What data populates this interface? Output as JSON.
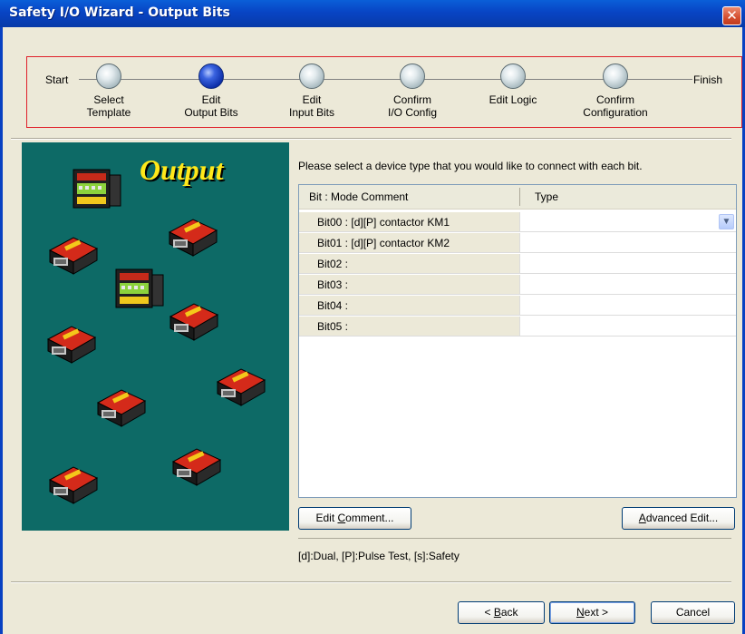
{
  "window": {
    "title": "Safety I/O Wizard - Output Bits"
  },
  "progress": {
    "start_label": "Start",
    "finish_label": "Finish",
    "steps": [
      {
        "label_line1": "Select",
        "label_line2": "Template",
        "active": false
      },
      {
        "label_line1": "Edit",
        "label_line2": "Output Bits",
        "active": true
      },
      {
        "label_line1": "Edit",
        "label_line2": "Input Bits",
        "active": false
      },
      {
        "label_line1": "Confirm",
        "label_line2": "I/O Config",
        "active": false
      },
      {
        "label_line1": "Edit Logic",
        "label_line2": "",
        "active": false
      },
      {
        "label_line1": "Confirm",
        "label_line2": "Configuration",
        "active": false
      }
    ]
  },
  "left_panel": {
    "title": "Output",
    "image": "safety-device-illustration"
  },
  "main": {
    "instruction": "Please select a device type that you would like to connect with each bit.",
    "grid": {
      "columns": [
        "Bit : Mode Comment",
        "Type"
      ],
      "rows": [
        {
          "bit": "Bit00 : [d][P] contactor KM1",
          "type": ""
        },
        {
          "bit": "Bit01 : [d][P] contactor KM2",
          "type": ""
        },
        {
          "bit": "Bit02 :",
          "type": ""
        },
        {
          "bit": "Bit03 :",
          "type": ""
        },
        {
          "bit": "Bit04 :",
          "type": ""
        },
        {
          "bit": "Bit05 :",
          "type": ""
        }
      ]
    },
    "edit_comment_label_pre": "Edit ",
    "edit_comment_label_u": "C",
    "edit_comment_label_post": "omment...",
    "advanced_edit_label_u": "A",
    "advanced_edit_label_post": "dvanced Edit...",
    "legend": "[d]:Dual, [P]:Pulse Test, [s]:Safety"
  },
  "footer": {
    "back_label_pre": "< ",
    "back_label_u": "B",
    "back_label_post": "ack",
    "next_label_u": "N",
    "next_label_post": "ext >",
    "cancel_label": "Cancel"
  },
  "colors": {
    "titlebar": "#0a5fd8",
    "panel": "#0d6a66",
    "title_text": "#ffe81a",
    "step_border": "#e0202a"
  }
}
